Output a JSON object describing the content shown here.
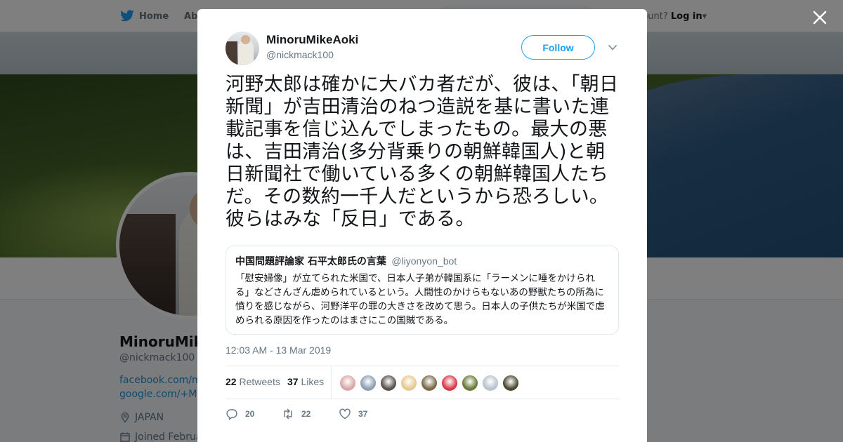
{
  "topnav": {
    "home_label": "Home",
    "about_label": "Abo",
    "account_prompt": "ccount?",
    "login_label": "Log in"
  },
  "profile": {
    "name": "MinoruMike",
    "handle": "@nickmack100",
    "link1": "facebook.com/mir",
    "link2": "google.com/+Mino",
    "location": "JAPAN",
    "joined": "Joined Februa"
  },
  "modal": {
    "close_icon": "close-icon",
    "author": {
      "name": "MinoruMikeAoki",
      "handle": "@nickmack100"
    },
    "follow_label": "Follow",
    "tweet_text": "河野太郎は確かに大バカ者だが、彼は、「朝日新聞」が吉田清治のねつ造説を基に書いた連載記事を信じ込んでしまったもの。最大の悪は、吉田清治(多分背乗りの朝鮮韓国人)と朝日新聞社で働いている多くの朝鮮韓国人たちだ。その数約一千人だというから恐ろしい。彼らはみな「反日」である。",
    "quoted": {
      "name": "中国問題評論家 石平太郎氏の言葉",
      "handle": "@liyonyon_bot",
      "text": "「慰安婦像」が立てられた米国で、日本人子弟が韓国系に「ラーメンに唾をかけられる」などさんざん虐められているという。人間性のかけらもないあの野獣たちの所為に憤りを感じながら、河野洋平の罪の大きさを改めて思う。日本人の子供たちが米国で虐められる原因を作ったのはまさにこの国賊である。"
    },
    "timestamp": "12:03 AM - 13 Mar 2019",
    "stats": {
      "retweets_count": "22",
      "retweets_label": "Retweets",
      "likes_count": "37",
      "likes_label": "Likes"
    },
    "likers": [
      {
        "color": "#d9a7a7"
      },
      {
        "color": "#8e9fb3"
      },
      {
        "color": "#5a534d"
      },
      {
        "color": "#e7c98f"
      },
      {
        "color": "#7a6a4a"
      },
      {
        "color": "#d83a4a"
      },
      {
        "color": "#6b7a3a"
      },
      {
        "color": "#b9c3cc"
      },
      {
        "color": "#4a4a32"
      }
    ],
    "actions": {
      "reply_count": "20",
      "retweet_count": "22",
      "like_count": "37"
    }
  },
  "colors": {
    "accent": "#1da1f2",
    "secondary_text": "#657786",
    "link": "#1b95e0"
  }
}
